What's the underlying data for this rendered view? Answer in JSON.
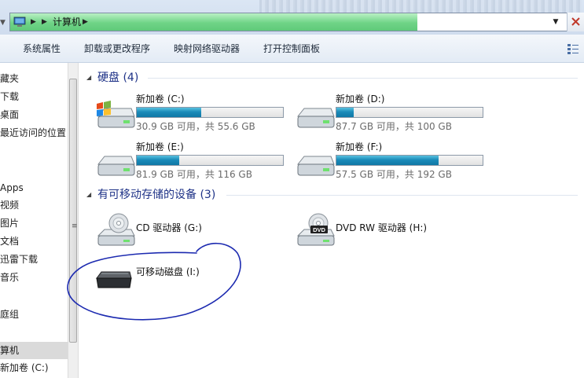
{
  "address": {
    "location": "计算机",
    "progress": 0.72
  },
  "toolbar": {
    "system_properties": "系统属性",
    "uninstall": "卸载或更改程序",
    "map_drive": "映射网络驱动器",
    "control_panel": "打开控制面板"
  },
  "nav": {
    "items": [
      "藏夹",
      "下载",
      "桌面",
      "最近访问的位置",
      "Apps",
      "视频",
      "图片",
      "文档",
      "迅雷下载",
      "音乐",
      "庭组",
      "算机",
      "新加卷 (C:)"
    ]
  },
  "groups": {
    "hard_disks": "硬盘 (4)",
    "removable": "有可移动存储的设备 (3)"
  },
  "drives": [
    {
      "name": "新加卷 (C:)",
      "space": "30.9 GB 可用，共 55.6 GB",
      "used_fraction": 0.44,
      "system": true
    },
    {
      "name": "新加卷 (D:)",
      "space": "87.7 GB 可用，共 100 GB",
      "used_fraction": 0.12,
      "system": false
    },
    {
      "name": "新加卷 (E:)",
      "space": "81.9 GB 可用，共 116 GB",
      "used_fraction": 0.29,
      "system": false
    },
    {
      "name": "新加卷 (F:)",
      "space": "57.5 GB 可用，共 192 GB",
      "used_fraction": 0.7,
      "system": false
    }
  ],
  "devices": [
    {
      "name": "CD 驱动器 (G:)"
    },
    {
      "name": "DVD RW 驱动器 (H:)",
      "badge": "DVD"
    },
    {
      "name": "可移动磁盘 (I:)"
    }
  ],
  "colors": {
    "group_title": "#1e3287",
    "bar_fill": "#1b8bb9",
    "address_progress": "#6fd487",
    "annotation_ink": "#1c2ab0"
  },
  "icons": {
    "address": "computer-icon",
    "close": "close-icon",
    "view": "view-options-icon",
    "drive": "hard-drive-icon",
    "cd": "cd-drive-icon",
    "dvd": "dvd-drive-icon",
    "removable": "removable-disk-icon"
  }
}
